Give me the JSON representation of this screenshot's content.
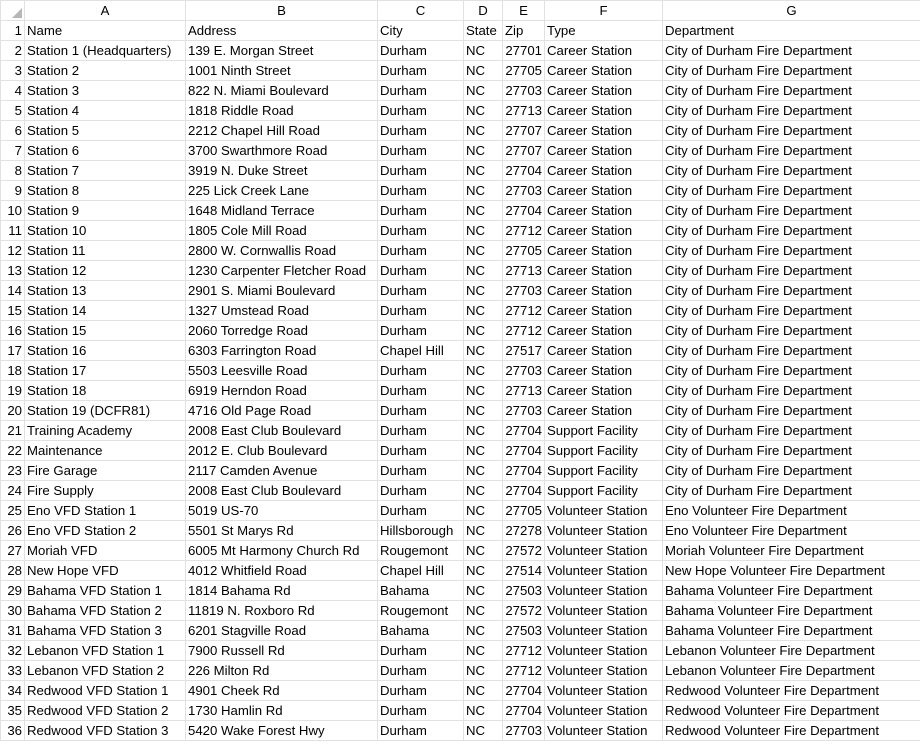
{
  "columns": [
    "A",
    "B",
    "C",
    "D",
    "E",
    "F",
    "G"
  ],
  "rows": [
    [
      "Name",
      "Address",
      "City",
      "State",
      "Zip",
      "Type",
      "Department"
    ],
    [
      "Station 1 (Headquarters)",
      "139 E. Morgan Street",
      "Durham",
      "NC",
      "27701",
      "Career Station",
      "City of Durham Fire Department"
    ],
    [
      "Station 2",
      "1001 Ninth Street",
      "Durham",
      "NC",
      "27705",
      "Career Station",
      "City of Durham Fire Department"
    ],
    [
      "Station 3",
      "822 N. Miami Boulevard",
      "Durham",
      "NC",
      "27703",
      "Career Station",
      "City of Durham Fire Department"
    ],
    [
      "Station 4",
      "1818 Riddle Road",
      "Durham",
      "NC",
      "27713",
      "Career Station",
      "City of Durham Fire Department"
    ],
    [
      "Station 5",
      "2212 Chapel Hill Road",
      "Durham",
      "NC",
      "27707",
      "Career Station",
      "City of Durham Fire Department"
    ],
    [
      "Station 6",
      "3700 Swarthmore Road",
      "Durham",
      "NC",
      "27707",
      "Career Station",
      "City of Durham Fire Department"
    ],
    [
      "Station 7",
      "3919 N. Duke Street",
      "Durham",
      "NC",
      "27704",
      "Career Station",
      "City of Durham Fire Department"
    ],
    [
      "Station 8",
      "225 Lick Creek Lane",
      "Durham",
      "NC",
      "27703",
      "Career Station",
      "City of Durham Fire Department"
    ],
    [
      "Station 9",
      "1648 Midland Terrace",
      "Durham",
      "NC",
      "27704",
      "Career Station",
      "City of Durham Fire Department"
    ],
    [
      "Station 10",
      "1805 Cole Mill Road",
      "Durham",
      "NC",
      "27712",
      "Career Station",
      "City of Durham Fire Department"
    ],
    [
      "Station 11",
      "2800 W. Cornwallis Road",
      "Durham",
      "NC",
      "27705",
      "Career Station",
      "City of Durham Fire Department"
    ],
    [
      "Station 12",
      "1230 Carpenter Fletcher Road",
      "Durham",
      "NC",
      "27713",
      "Career Station",
      "City of Durham Fire Department"
    ],
    [
      "Station 13",
      "2901 S. Miami Boulevard",
      "Durham",
      "NC",
      "27703",
      "Career Station",
      "City of Durham Fire Department"
    ],
    [
      "Station 14",
      "1327 Umstead Road",
      "Durham",
      "NC",
      "27712",
      "Career Station",
      "City of Durham Fire Department"
    ],
    [
      "Station 15",
      "2060 Torredge Road",
      "Durham",
      "NC",
      "27712",
      "Career Station",
      "City of Durham Fire Department"
    ],
    [
      "Station 16",
      "6303 Farrington Road",
      "Chapel Hill",
      "NC",
      "27517",
      "Career Station",
      "City of Durham Fire Department"
    ],
    [
      "Station 17",
      "5503 Leesville Road",
      "Durham",
      "NC",
      "27703",
      "Career Station",
      "City of Durham Fire Department"
    ],
    [
      "Station 18",
      "6919 Herndon Road",
      "Durham",
      "NC",
      "27713",
      "Career Station",
      "City of Durham Fire Department"
    ],
    [
      "Station 19 (DCFR81)",
      "4716 Old Page Road",
      "Durham",
      "NC",
      "27703",
      "Career Station",
      "City of Durham Fire Department"
    ],
    [
      "Training Academy",
      "2008 East Club Boulevard",
      "Durham",
      "NC",
      "27704",
      "Support Facility",
      "City of Durham Fire Department"
    ],
    [
      "Maintenance",
      "2012 E. Club Boulevard",
      "Durham",
      "NC",
      "27704",
      "Support Facility",
      "City of Durham Fire Department"
    ],
    [
      "Fire Garage",
      "2117 Camden Avenue",
      "Durham",
      "NC",
      "27704",
      "Support Facility",
      "City of Durham Fire Department"
    ],
    [
      "Fire Supply",
      "2008 East Club Boulevard",
      "Durham",
      "NC",
      "27704",
      "Support Facility",
      "City of Durham Fire Department"
    ],
    [
      "Eno VFD Station 1",
      "5019 US-70",
      "Durham",
      "NC",
      "27705",
      "Volunteer Station",
      "Eno Volunteer Fire Department"
    ],
    [
      "Eno VFD Station 2",
      "5501 St Marys Rd",
      "Hillsborough",
      "NC",
      "27278",
      "Volunteer Station",
      "Eno Volunteer Fire Department"
    ],
    [
      "Moriah VFD",
      "6005 Mt Harmony Church Rd",
      "Rougemont",
      "NC",
      "27572",
      "Volunteer Station",
      "Moriah Volunteer Fire Department"
    ],
    [
      "New Hope VFD",
      "4012 Whitfield Road",
      "Chapel Hill",
      "NC",
      "27514",
      "Volunteer Station",
      "New Hope Volunteer Fire Department"
    ],
    [
      "Bahama VFD Station 1",
      "1814 Bahama Rd",
      "Bahama",
      "NC",
      "27503",
      "Volunteer Station",
      "Bahama Volunteer Fire Department"
    ],
    [
      "Bahama VFD Station 2",
      "11819 N. Roxboro Rd",
      "Rougemont",
      "NC",
      "27572",
      "Volunteer Station",
      "Bahama Volunteer Fire Department"
    ],
    [
      "Bahama VFD Station 3",
      "6201 Stagville Road",
      "Bahama",
      "NC",
      "27503",
      "Volunteer Station",
      "Bahama Volunteer Fire Department"
    ],
    [
      "Lebanon VFD Station 1",
      "7900 Russell Rd",
      "Durham",
      "NC",
      "27712",
      "Volunteer Station",
      "Lebanon Volunteer Fire Department"
    ],
    [
      "Lebanon VFD Station 2",
      "226 Milton Rd",
      "Durham",
      "NC",
      "27712",
      "Volunteer Station",
      "Lebanon Volunteer Fire Department"
    ],
    [
      "Redwood VFD Station 1",
      "4901 Cheek Rd",
      "Durham",
      "NC",
      "27704",
      "Volunteer Station",
      "Redwood Volunteer Fire Department"
    ],
    [
      "Redwood VFD Station 2",
      "1730 Hamlin Rd",
      "Durham",
      "NC",
      "27704",
      "Volunteer Station",
      "Redwood Volunteer Fire Department"
    ],
    [
      "Redwood VFD Station 3",
      "5420 Wake Forest Hwy",
      "Durham",
      "NC",
      "27703",
      "Volunteer Station",
      "Redwood Volunteer Fire Department"
    ]
  ]
}
